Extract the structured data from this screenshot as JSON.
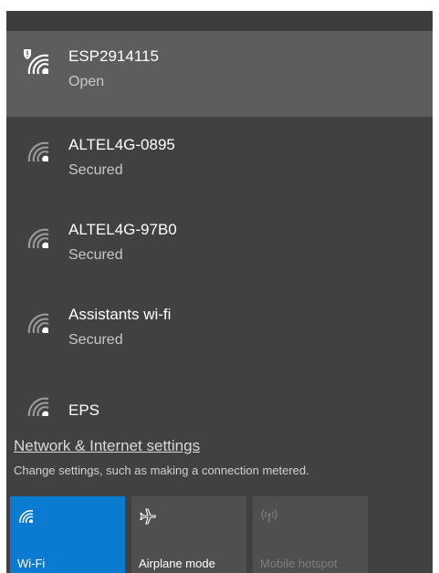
{
  "networks": [
    {
      "name": "ESP2914115",
      "status": "Open",
      "icon": "wifi-shield-icon"
    },
    {
      "name": "ALTEL4G-0895",
      "status": "Secured",
      "icon": "wifi-icon"
    },
    {
      "name": "ALTEL4G-97B0",
      "status": "Secured",
      "icon": "wifi-icon"
    },
    {
      "name": "Assistants wi-fi",
      "status": "Secured",
      "icon": "wifi-icon"
    },
    {
      "name": "EPS",
      "status": "",
      "icon": "wifi-icon"
    }
  ],
  "settings": {
    "link": "Network & Internet settings",
    "description": "Change settings, such as making a connection metered."
  },
  "quick_actions": [
    {
      "label": "Wi-Fi",
      "icon": "wifi-icon",
      "state": "on"
    },
    {
      "label": "Airplane mode",
      "icon": "airplane-icon",
      "state": "off"
    },
    {
      "label": "Mobile hotspot",
      "icon": "hotspot-icon",
      "state": "disabled"
    }
  ],
  "colors": {
    "panel": "#414141",
    "selected": "#5d5d5d",
    "accent": "#0b7ad1",
    "tile": "#4f4f4f"
  }
}
